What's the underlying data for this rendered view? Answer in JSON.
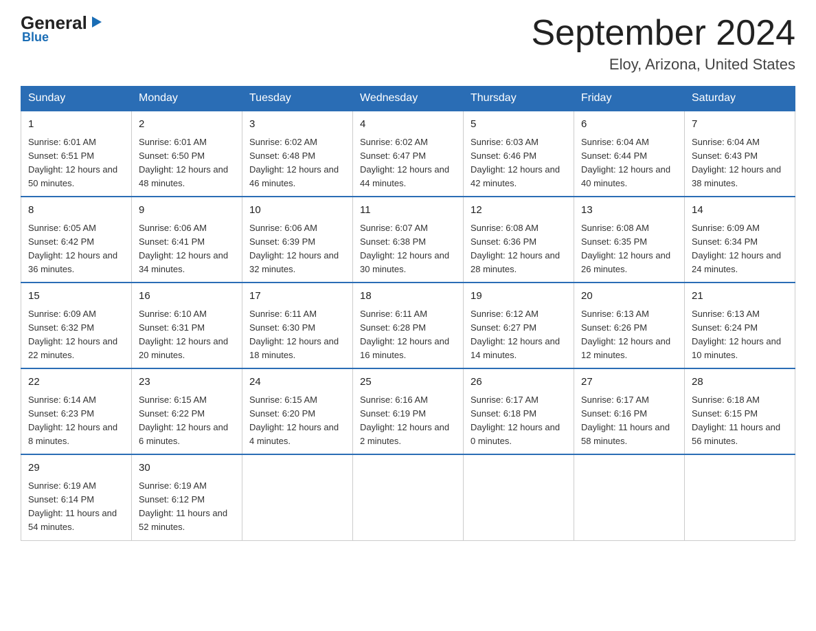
{
  "logo": {
    "general": "General",
    "blue": "Blue",
    "arrow": "▶"
  },
  "header": {
    "month_year": "September 2024",
    "location": "Eloy, Arizona, United States"
  },
  "days_of_week": [
    "Sunday",
    "Monday",
    "Tuesday",
    "Wednesday",
    "Thursday",
    "Friday",
    "Saturday"
  ],
  "weeks": [
    [
      {
        "day": "1",
        "sunrise": "6:01 AM",
        "sunset": "6:51 PM",
        "daylight": "12 hours and 50 minutes."
      },
      {
        "day": "2",
        "sunrise": "6:01 AM",
        "sunset": "6:50 PM",
        "daylight": "12 hours and 48 minutes."
      },
      {
        "day": "3",
        "sunrise": "6:02 AM",
        "sunset": "6:48 PM",
        "daylight": "12 hours and 46 minutes."
      },
      {
        "day": "4",
        "sunrise": "6:02 AM",
        "sunset": "6:47 PM",
        "daylight": "12 hours and 44 minutes."
      },
      {
        "day": "5",
        "sunrise": "6:03 AM",
        "sunset": "6:46 PM",
        "daylight": "12 hours and 42 minutes."
      },
      {
        "day": "6",
        "sunrise": "6:04 AM",
        "sunset": "6:44 PM",
        "daylight": "12 hours and 40 minutes."
      },
      {
        "day": "7",
        "sunrise": "6:04 AM",
        "sunset": "6:43 PM",
        "daylight": "12 hours and 38 minutes."
      }
    ],
    [
      {
        "day": "8",
        "sunrise": "6:05 AM",
        "sunset": "6:42 PM",
        "daylight": "12 hours and 36 minutes."
      },
      {
        "day": "9",
        "sunrise": "6:06 AM",
        "sunset": "6:41 PM",
        "daylight": "12 hours and 34 minutes."
      },
      {
        "day": "10",
        "sunrise": "6:06 AM",
        "sunset": "6:39 PM",
        "daylight": "12 hours and 32 minutes."
      },
      {
        "day": "11",
        "sunrise": "6:07 AM",
        "sunset": "6:38 PM",
        "daylight": "12 hours and 30 minutes."
      },
      {
        "day": "12",
        "sunrise": "6:08 AM",
        "sunset": "6:36 PM",
        "daylight": "12 hours and 28 minutes."
      },
      {
        "day": "13",
        "sunrise": "6:08 AM",
        "sunset": "6:35 PM",
        "daylight": "12 hours and 26 minutes."
      },
      {
        "day": "14",
        "sunrise": "6:09 AM",
        "sunset": "6:34 PM",
        "daylight": "12 hours and 24 minutes."
      }
    ],
    [
      {
        "day": "15",
        "sunrise": "6:09 AM",
        "sunset": "6:32 PM",
        "daylight": "12 hours and 22 minutes."
      },
      {
        "day": "16",
        "sunrise": "6:10 AM",
        "sunset": "6:31 PM",
        "daylight": "12 hours and 20 minutes."
      },
      {
        "day": "17",
        "sunrise": "6:11 AM",
        "sunset": "6:30 PM",
        "daylight": "12 hours and 18 minutes."
      },
      {
        "day": "18",
        "sunrise": "6:11 AM",
        "sunset": "6:28 PM",
        "daylight": "12 hours and 16 minutes."
      },
      {
        "day": "19",
        "sunrise": "6:12 AM",
        "sunset": "6:27 PM",
        "daylight": "12 hours and 14 minutes."
      },
      {
        "day": "20",
        "sunrise": "6:13 AM",
        "sunset": "6:26 PM",
        "daylight": "12 hours and 12 minutes."
      },
      {
        "day": "21",
        "sunrise": "6:13 AM",
        "sunset": "6:24 PM",
        "daylight": "12 hours and 10 minutes."
      }
    ],
    [
      {
        "day": "22",
        "sunrise": "6:14 AM",
        "sunset": "6:23 PM",
        "daylight": "12 hours and 8 minutes."
      },
      {
        "day": "23",
        "sunrise": "6:15 AM",
        "sunset": "6:22 PM",
        "daylight": "12 hours and 6 minutes."
      },
      {
        "day": "24",
        "sunrise": "6:15 AM",
        "sunset": "6:20 PM",
        "daylight": "12 hours and 4 minutes."
      },
      {
        "day": "25",
        "sunrise": "6:16 AM",
        "sunset": "6:19 PM",
        "daylight": "12 hours and 2 minutes."
      },
      {
        "day": "26",
        "sunrise": "6:17 AM",
        "sunset": "6:18 PM",
        "daylight": "12 hours and 0 minutes."
      },
      {
        "day": "27",
        "sunrise": "6:17 AM",
        "sunset": "6:16 PM",
        "daylight": "11 hours and 58 minutes."
      },
      {
        "day": "28",
        "sunrise": "6:18 AM",
        "sunset": "6:15 PM",
        "daylight": "11 hours and 56 minutes."
      }
    ],
    [
      {
        "day": "29",
        "sunrise": "6:19 AM",
        "sunset": "6:14 PM",
        "daylight": "11 hours and 54 minutes."
      },
      {
        "day": "30",
        "sunrise": "6:19 AM",
        "sunset": "6:12 PM",
        "daylight": "11 hours and 52 minutes."
      },
      null,
      null,
      null,
      null,
      null
    ]
  ]
}
